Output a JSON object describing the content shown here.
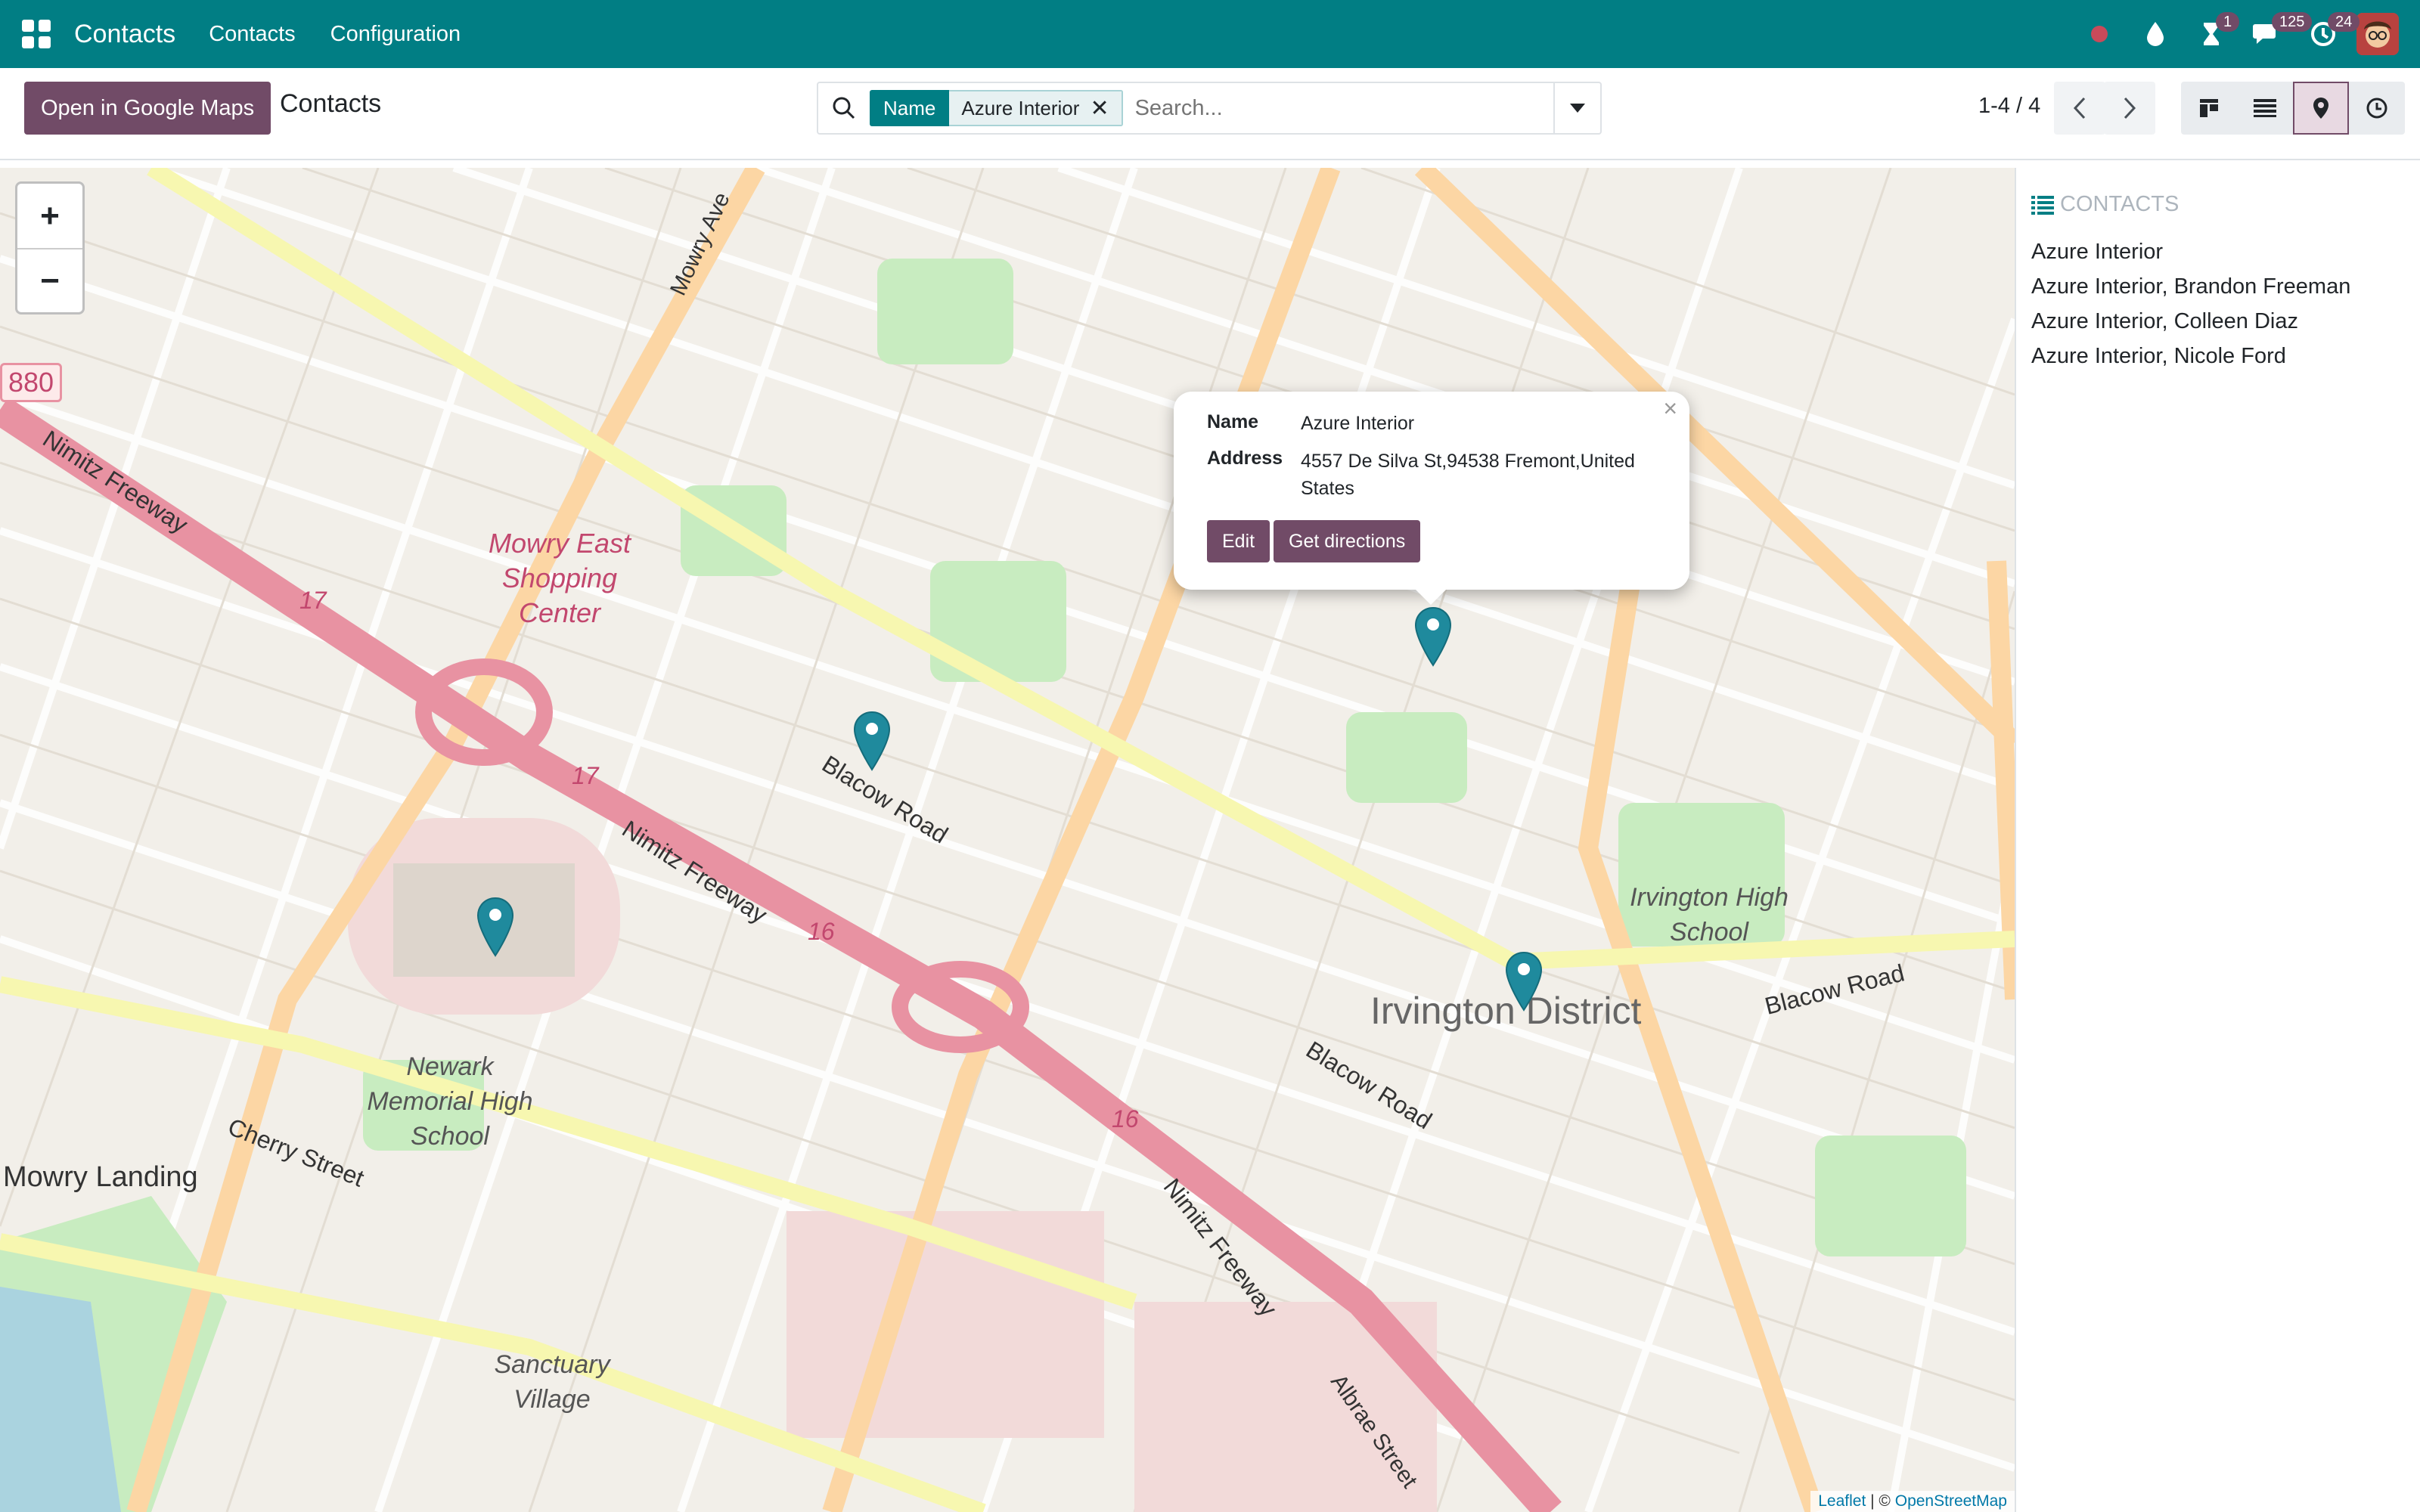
{
  "navbar": {
    "brand": "Contacts",
    "menu": [
      "Contacts",
      "Configuration"
    ],
    "badges": {
      "activity": "1",
      "messages": "125",
      "clock": "24"
    }
  },
  "control": {
    "google_maps_button": "Open in Google Maps",
    "breadcrumb": "Contacts",
    "search": {
      "facet_label": "Name",
      "facet_value": "Azure Interior",
      "placeholder": "Search..."
    },
    "pager": "1-4 / 4"
  },
  "map": {
    "zoom_in": "+",
    "zoom_out": "−",
    "place_labels": [
      "Mowry East Shopping Center",
      "Blacow Road",
      "Blacow Road",
      "Blacow Road",
      "Nimitz Freeway",
      "Nimitz Freeway",
      "Nimitz Freeway",
      "Irvington District",
      "Irvington High School",
      "Newark Memorial High School",
      "Cherry Street",
      "Mowry Landing",
      "Sanctuary Village",
      "Mowry Ave",
      "Albrae Street",
      "880",
      "17",
      "17",
      "16",
      "16"
    ],
    "popup": {
      "name_label": "Name",
      "name_value": "Azure Interior",
      "address_label": "Address",
      "address_value": "4557 De Silva St,94538 Fremont,United States",
      "edit_button": "Edit",
      "directions_button": "Get directions",
      "close": "×"
    },
    "attribution": {
      "leaflet": "Leaflet",
      "sep": " | © ",
      "osm": "OpenStreetMap"
    }
  },
  "sidebar": {
    "title": "CONTACTS",
    "items": [
      "Azure Interior",
      "Azure Interior, Brandon Freeman",
      "Azure Interior, Colleen Diaz",
      "Azure Interior, Nicole Ford"
    ]
  },
  "colors": {
    "teal": "#017e84",
    "purple": "#714b67",
    "marker": "#1f8a9d"
  }
}
